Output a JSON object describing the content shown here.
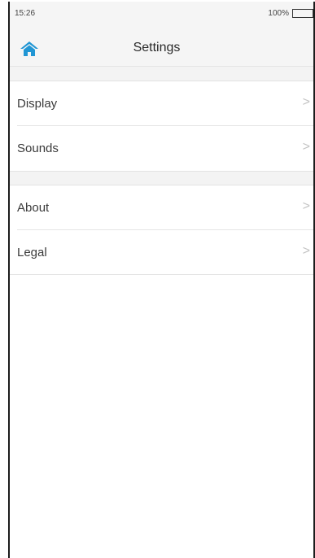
{
  "status_bar": {
    "time": "15:26",
    "battery": "100%"
  },
  "nav": {
    "title": "Settings",
    "home_icon": "home-icon"
  },
  "groups": [
    {
      "items": [
        {
          "label": "Display"
        },
        {
          "label": "Sounds"
        }
      ]
    },
    {
      "items": [
        {
          "label": "About"
        },
        {
          "label": "Legal"
        }
      ]
    }
  ],
  "chevron": ">",
  "colors": {
    "accent": "#2196d4",
    "background": "#f5f5f5",
    "separator": "#e4e4e4"
  }
}
